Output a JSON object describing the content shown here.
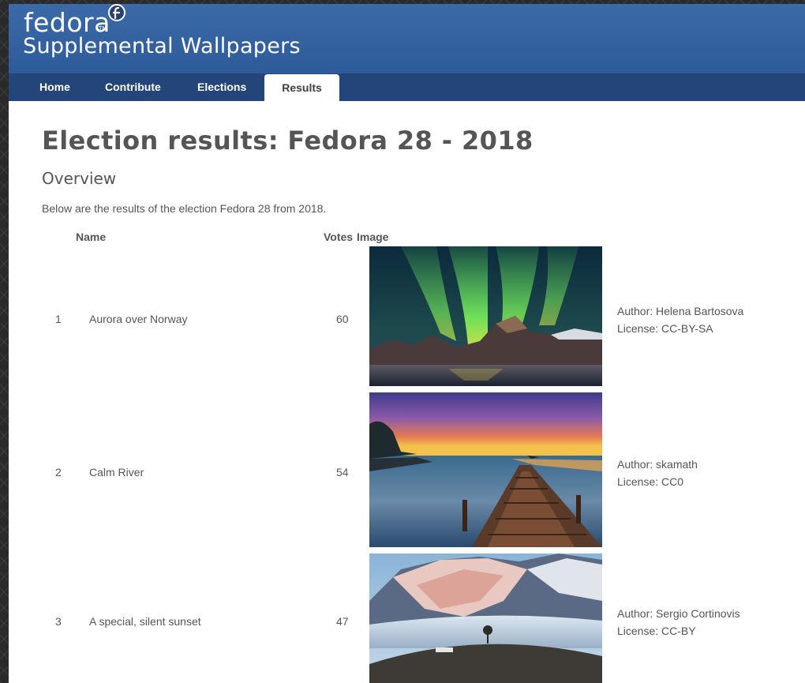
{
  "brand": {
    "logo": "fedora",
    "tm": "TM",
    "subtitle": "Supplemental Wallpapers"
  },
  "nav": {
    "items": [
      {
        "label": "Home",
        "active": false
      },
      {
        "label": "Contribute",
        "active": false
      },
      {
        "label": "Elections",
        "active": false
      },
      {
        "label": "Results",
        "active": true
      }
    ]
  },
  "page": {
    "title": "Election results: Fedora 28 - 2018",
    "section": "Overview",
    "intro": "Below are the results of the election Fedora 28 from 2018."
  },
  "table": {
    "headers": {
      "name": "Name",
      "votes": "Votes",
      "image": "Image"
    },
    "rows": [
      {
        "rank": "1",
        "name": "Aurora over Norway",
        "votes": "60",
        "author": "Author: Helena Bartosova",
        "license": "License: CC-BY-SA",
        "image": "aurora-mountain-lake"
      },
      {
        "rank": "2",
        "name": "Calm River",
        "votes": "54",
        "author": "Author: skamath",
        "license": "License: CC0",
        "image": "wooden-pier-sunset"
      },
      {
        "rank": "3",
        "name": "A special, silent sunset",
        "votes": "47",
        "author": "Author: Sergio Cortinovis",
        "license": "License: CC-BY",
        "image": "snowy-mountain-lone-tree"
      }
    ]
  },
  "colors": {
    "banner": "#2e5b99",
    "nav": "#23457a",
    "text": "#555555"
  }
}
